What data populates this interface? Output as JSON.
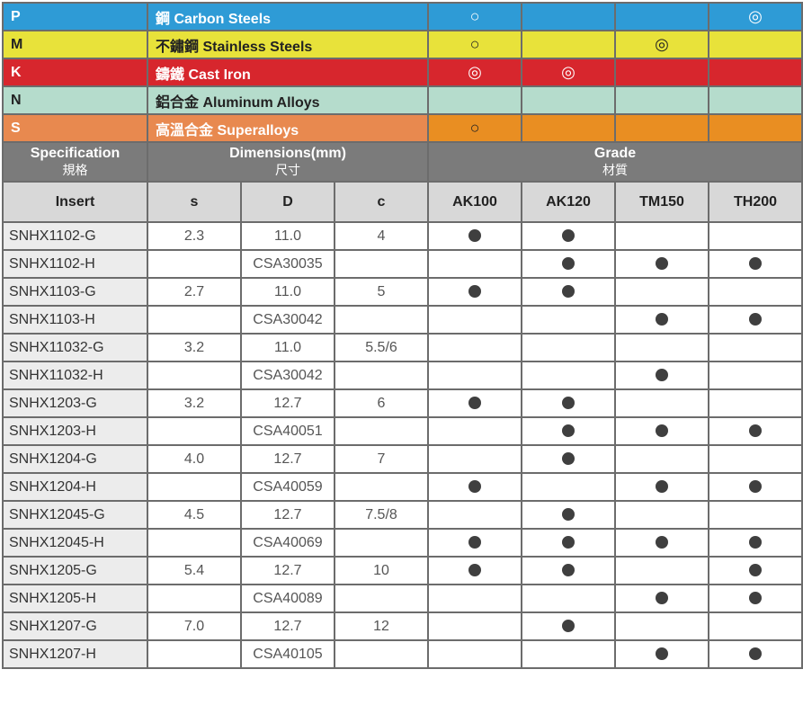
{
  "materials": [
    {
      "code": "P",
      "name": "鋼 Carbon Steels",
      "marks": [
        "○",
        "",
        "",
        "◎"
      ]
    },
    {
      "code": "M",
      "name": "不鏽鋼 Stainless Steels",
      "marks": [
        "○",
        "",
        "◎",
        ""
      ]
    },
    {
      "code": "K",
      "name": "鑄鐵 Cast Iron",
      "marks": [
        "◎",
        "◎",
        "",
        ""
      ]
    },
    {
      "code": "N",
      "name": "鋁合金 Aluminum Alloys",
      "marks": [
        "",
        "",
        "",
        ""
      ]
    },
    {
      "code": "S",
      "name": "高溫合金 Superalloys",
      "marks": [
        "○",
        "",
        "",
        ""
      ]
    }
  ],
  "headers": {
    "specification": "Specification",
    "specification_zh": "規格",
    "dimensions": "Dimensions(mm)",
    "dimensions_zh": "尺寸",
    "grade": "Grade",
    "grade_zh": "材質"
  },
  "columns": [
    "Insert",
    "s",
    "D",
    "c",
    "AK100",
    "AK120",
    "TM150",
    "TH200"
  ],
  "rows": [
    {
      "insert": "SNHX1102-G",
      "s": "2.3",
      "d": "11.0",
      "c": "4",
      "grades": [
        true,
        true,
        false,
        false
      ]
    },
    {
      "insert": "SNHX1102-H",
      "s": "",
      "d": "CSA30035",
      "c": "",
      "grades": [
        false,
        true,
        true,
        true
      ]
    },
    {
      "insert": "SNHX1103-G",
      "s": "2.7",
      "d": "11.0",
      "c": "5",
      "grades": [
        true,
        true,
        false,
        false
      ]
    },
    {
      "insert": "SNHX1103-H",
      "s": "",
      "d": "CSA30042",
      "c": "",
      "grades": [
        false,
        false,
        true,
        true
      ]
    },
    {
      "insert": "SNHX11032-G",
      "s": "3.2",
      "d": "11.0",
      "c": "5.5/6",
      "grades": [
        false,
        false,
        false,
        false
      ]
    },
    {
      "insert": "SNHX11032-H",
      "s": "",
      "d": "CSA30042",
      "c": "",
      "grades": [
        false,
        false,
        true,
        false
      ]
    },
    {
      "insert": "SNHX1203-G",
      "s": "3.2",
      "d": "12.7",
      "c": "6",
      "grades": [
        true,
        true,
        false,
        false
      ]
    },
    {
      "insert": "SNHX1203-H",
      "s": "",
      "d": "CSA40051",
      "c": "",
      "grades": [
        false,
        true,
        true,
        true
      ]
    },
    {
      "insert": "SNHX1204-G",
      "s": "4.0",
      "d": "12.7",
      "c": "7",
      "grades": [
        false,
        true,
        false,
        false
      ]
    },
    {
      "insert": "SNHX1204-H",
      "s": "",
      "d": "CSA40059",
      "c": "",
      "grades": [
        true,
        false,
        true,
        true
      ]
    },
    {
      "insert": "SNHX12045-G",
      "s": "4.5",
      "d": "12.7",
      "c": "7.5/8",
      "grades": [
        false,
        true,
        false,
        false
      ]
    },
    {
      "insert": "SNHX12045-H",
      "s": "",
      "d": "CSA40069",
      "c": "",
      "grades": [
        true,
        true,
        true,
        true
      ]
    },
    {
      "insert": "SNHX1205-G",
      "s": "5.4",
      "d": "12.7",
      "c": "10",
      "grades": [
        true,
        true,
        false,
        true
      ]
    },
    {
      "insert": "SNHX1205-H",
      "s": "",
      "d": "CSA40089",
      "c": "",
      "grades": [
        false,
        false,
        true,
        true
      ]
    },
    {
      "insert": "SNHX1207-G",
      "s": "7.0",
      "d": "12.7",
      "c": "12",
      "grades": [
        false,
        true,
        false,
        false
      ]
    },
    {
      "insert": "SNHX1207-H",
      "s": "",
      "d": "CSA40105",
      "c": "",
      "grades": [
        false,
        false,
        true,
        true
      ]
    }
  ],
  "colors": {
    "carbon": "#2e9bd6",
    "stainless": "#e8e23a",
    "cast_iron": "#d7262d",
    "aluminum": "#b5dccc",
    "superalloy": "#e98e22",
    "header_gray": "#7b7b7b",
    "column_gray": "#d8d8d8"
  },
  "icons": {
    "dot": "filled-circle-icon"
  }
}
